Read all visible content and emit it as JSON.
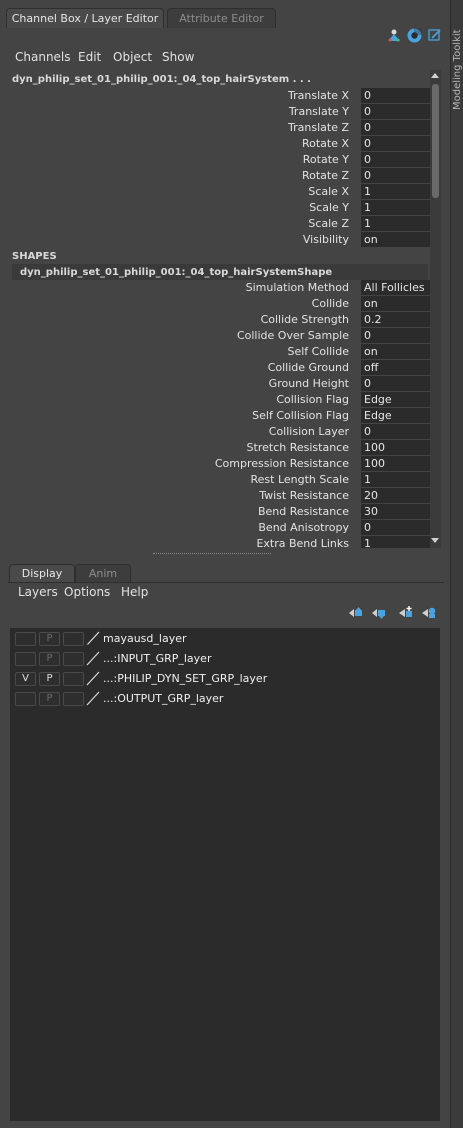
{
  "tabs": {
    "channel_box": "Channel Box / Layer Editor",
    "attribute_editor": "Attribute Editor"
  },
  "menu": {
    "channels": "Channels",
    "edit": "Edit",
    "object": "Object",
    "show": "Show"
  },
  "right_strip": {
    "label": "Modeling Toolkit"
  },
  "channel_box": {
    "node_name": "dyn_philip_set_01_philip_001:_04_top_hairSystem . . .",
    "transform_attrs": [
      {
        "label": "Translate X",
        "value": "0"
      },
      {
        "label": "Translate Y",
        "value": "0"
      },
      {
        "label": "Translate Z",
        "value": "0"
      },
      {
        "label": "Rotate X",
        "value": "0"
      },
      {
        "label": "Rotate Y",
        "value": "0"
      },
      {
        "label": "Rotate Z",
        "value": "0"
      },
      {
        "label": "Scale X",
        "value": "1"
      },
      {
        "label": "Scale Y",
        "value": "1"
      },
      {
        "label": "Scale Z",
        "value": "1"
      },
      {
        "label": "Visibility",
        "value": "on"
      }
    ],
    "shapes_title": "SHAPES",
    "shape_name": "dyn_philip_set_01_philip_001:_04_top_hairSystemShape",
    "shape_attrs": [
      {
        "label": "Simulation Method",
        "value": "All Follicles"
      },
      {
        "label": "Collide",
        "value": "on"
      },
      {
        "label": "Collide Strength",
        "value": "0.2"
      },
      {
        "label": "Collide Over Sample",
        "value": "0"
      },
      {
        "label": "Self Collide",
        "value": "on"
      },
      {
        "label": "Collide Ground",
        "value": "off"
      },
      {
        "label": "Ground Height",
        "value": "0"
      },
      {
        "label": "Collision Flag",
        "value": "Edge"
      },
      {
        "label": "Self Collision Flag",
        "value": "Edge"
      },
      {
        "label": "Collision Layer",
        "value": "0"
      },
      {
        "label": "Stretch Resistance",
        "value": "100"
      },
      {
        "label": "Compression Resistance",
        "value": "100"
      },
      {
        "label": "Rest Length Scale",
        "value": "1"
      },
      {
        "label": "Twist Resistance",
        "value": "20"
      },
      {
        "label": "Bend Resistance",
        "value": "30"
      },
      {
        "label": "Bend Anisotropy",
        "value": "0"
      },
      {
        "label": "Extra Bend Links",
        "value": "1"
      }
    ]
  },
  "layer_editor": {
    "tabs": {
      "display": "Display",
      "anim": "Anim"
    },
    "menu": {
      "layers": "Layers",
      "options": "Options",
      "help": "Help"
    },
    "layers": [
      {
        "v": "",
        "p": "P",
        "name": "mayausd_layer"
      },
      {
        "v": "",
        "p": "P",
        "name": "...:INPUT_GRP_layer"
      },
      {
        "v": "V",
        "p": "P",
        "name": "...:PHILIP_DYN_SET_GRP_layer"
      },
      {
        "v": "",
        "p": "P",
        "name": "...:OUTPUT_GRP_layer"
      }
    ]
  },
  "colors": {
    "panel": "#444444",
    "field": "#2b2b2b",
    "accent": "#4aa3df"
  }
}
